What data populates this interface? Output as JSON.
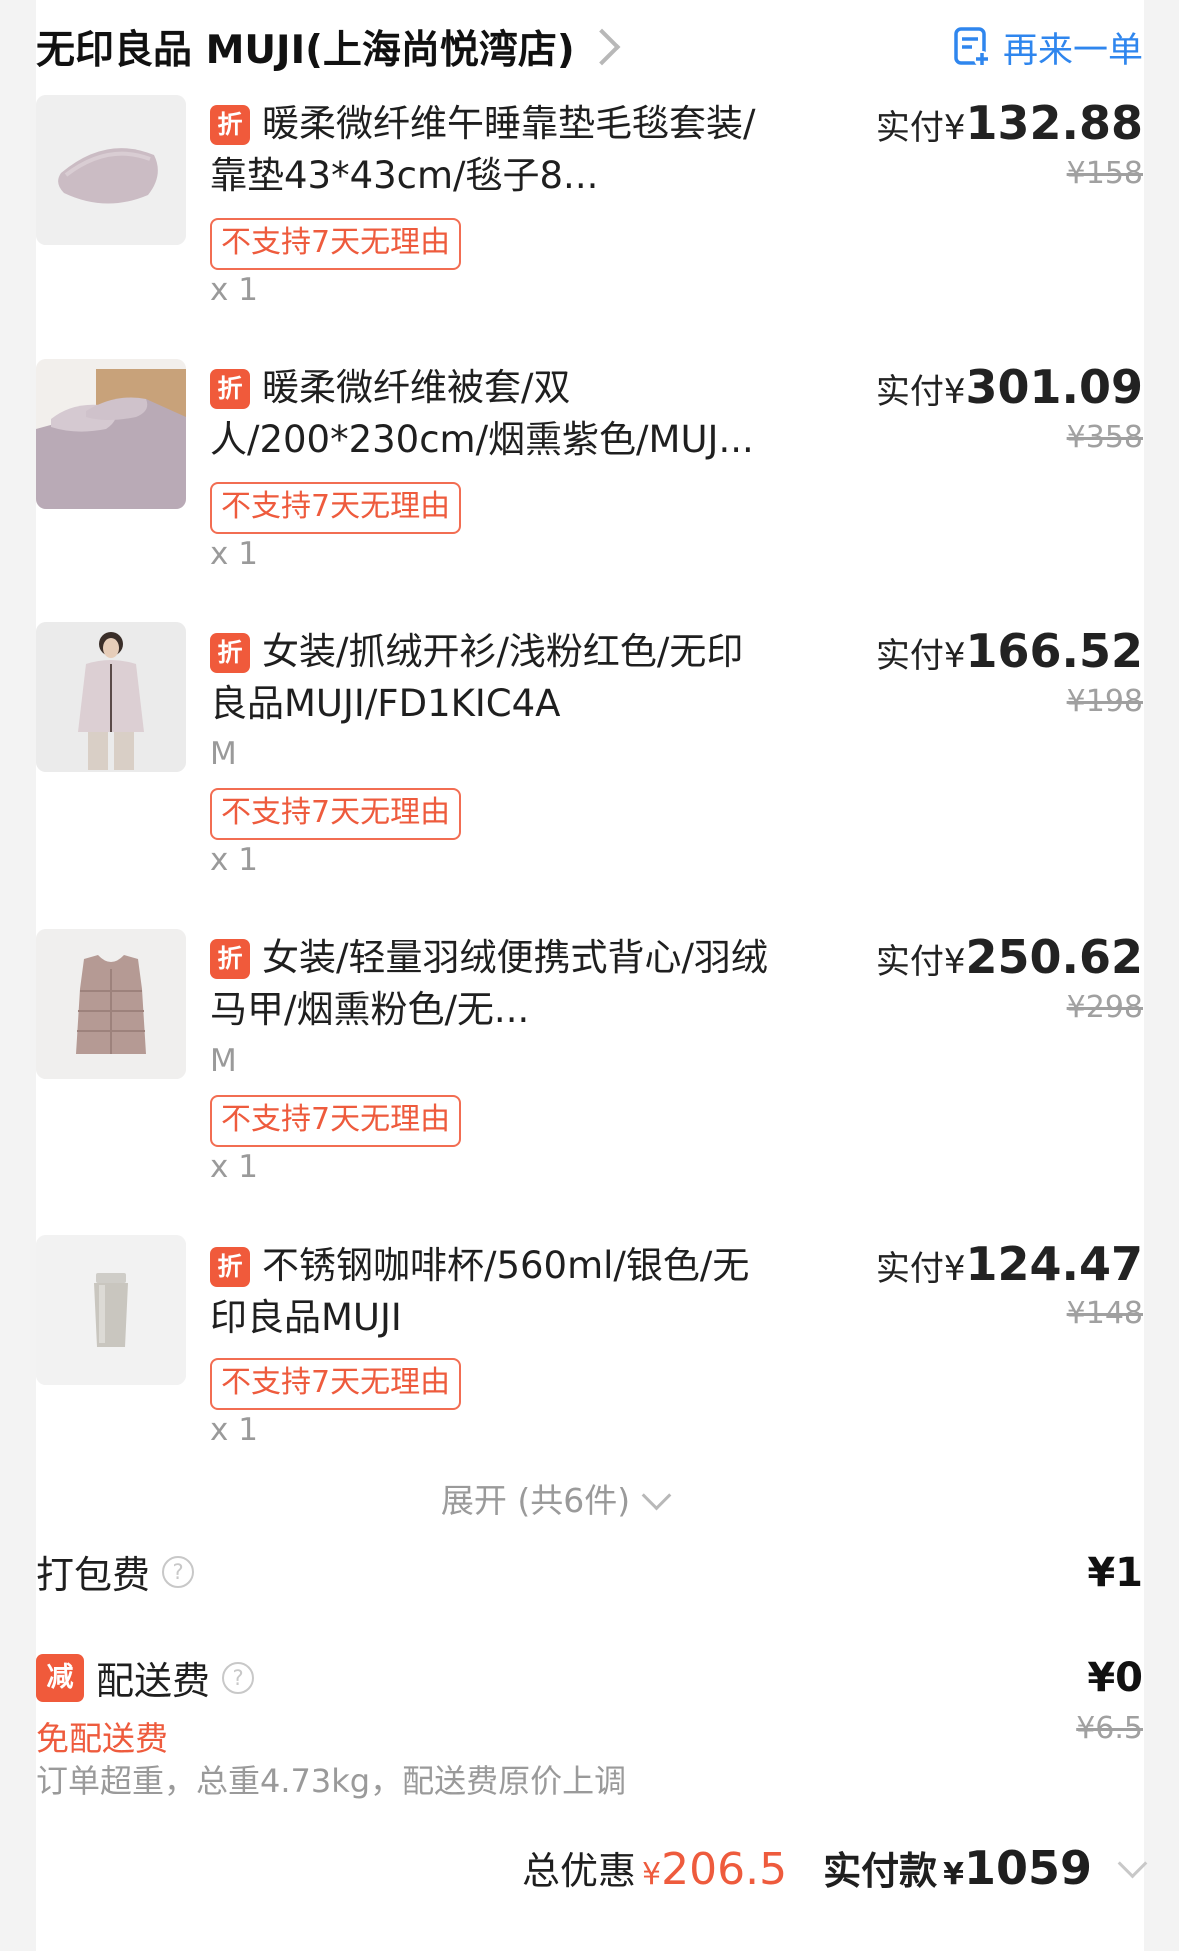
{
  "header": {
    "store_name": "无印良品 MUJI(上海尚悦湾店)",
    "reorder_label": "再来一单"
  },
  "discount_tag": "折",
  "items": [
    {
      "title": "暖柔微纤维午睡靠垫毛毯套装/靠垫43*43cm/毯子8...",
      "spec": "",
      "no_return": "不支持7天无理由",
      "qty": "x 1",
      "paid_label": "实付¥",
      "paid_amount": "132.88",
      "original_price": "¥158",
      "image": "pillow-blanket-set"
    },
    {
      "title": "暖柔微纤维被套/双人/200*230cm/烟熏紫色/MUJ...",
      "spec": "",
      "no_return": "不支持7天无理由",
      "qty": "x 1",
      "paid_label": "实付¥",
      "paid_amount": "301.09",
      "original_price": "¥358",
      "image": "duvet-cover"
    },
    {
      "title": "女装/抓绒开衫/浅粉红色/无印良品MUJI/FD1KIC4A",
      "spec": "M",
      "no_return": "不支持7天无理由",
      "qty": "x 1",
      "paid_label": "实付¥",
      "paid_amount": "166.52",
      "original_price": "¥198",
      "image": "fleece-cardigan"
    },
    {
      "title": "女装/轻量羽绒便携式背心/羽绒马甲/烟熏粉色/无...",
      "spec": "M",
      "no_return": "不支持7天无理由",
      "qty": "x 1",
      "paid_label": "实付¥",
      "paid_amount": "250.62",
      "original_price": "¥298",
      "image": "down-vest"
    },
    {
      "title": "不锈钢咖啡杯/560ml/银色/无印良品MUJI",
      "spec": "",
      "no_return": "不支持7天无理由",
      "qty": "x 1",
      "paid_label": "实付¥",
      "paid_amount": "124.47",
      "original_price": "¥148",
      "image": "steel-coffee-cup"
    }
  ],
  "expand_label": "展开 (共6件)",
  "packing_fee": {
    "label": "打包费",
    "help": "?",
    "amount": "¥1"
  },
  "delivery_fee": {
    "tag": "减",
    "label": "配送费",
    "help": "?",
    "amount": "¥0",
    "original": "¥6.5",
    "free_label": "免配送费",
    "note": "订单超重，总重4.73kg，配送费原价上调"
  },
  "totals": {
    "discount_label": "总优惠",
    "discount_symbol": "¥",
    "discount_value": "206.5",
    "paid_label": "实付款",
    "paid_symbol": "¥",
    "paid_value": "1059"
  },
  "colors": {
    "accent_red": "#ee5b3d",
    "link_blue": "#2f86ee"
  }
}
